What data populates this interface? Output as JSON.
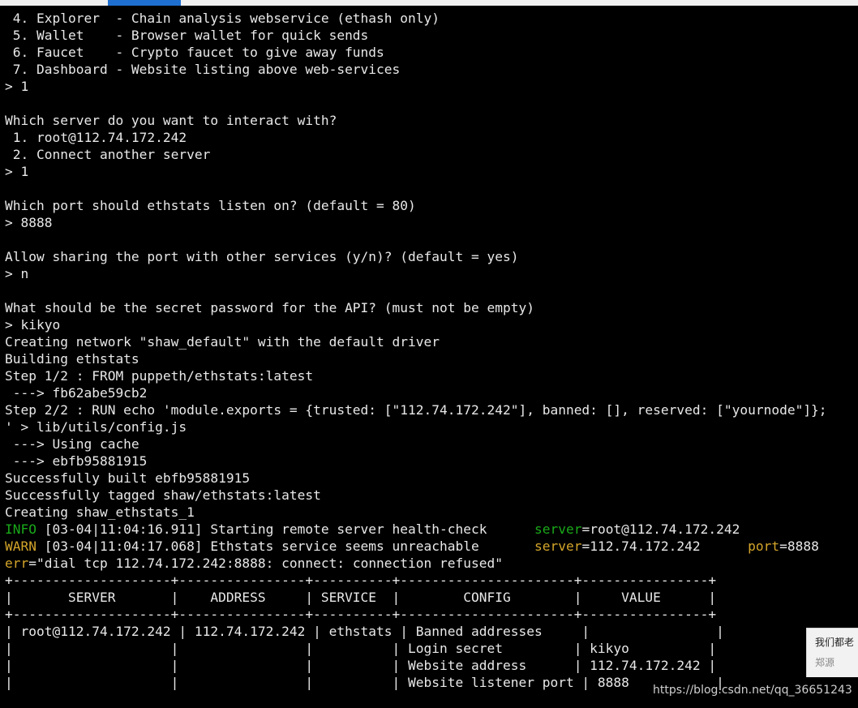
{
  "terminal": {
    "lines": [
      " 4. Explorer  - Chain analysis webservice (ethash only)",
      " 5. Wallet    - Browser wallet for quick sends",
      " 6. Faucet    - Crypto faucet to give away funds",
      " 7. Dashboard - Website listing above web-services",
      "> 1",
      "",
      "Which server do you want to interact with?",
      " 1. root@112.74.172.242",
      " 2. Connect another server",
      "> 1",
      "",
      "Which port should ethstats listen on? (default = 80)",
      "> 8888",
      "",
      "Allow sharing the port with other services (y/n)? (default = yes)",
      "> n",
      "",
      "What should be the secret password for the API? (must not be empty)",
      "> kikyo",
      "Creating network \"shaw_default\" with the default driver",
      "Building ethstats",
      "Step 1/2 : FROM puppeth/ethstats:latest",
      " ---> fb62abe59cb2",
      "Step 2/2 : RUN echo 'module.exports = {trusted: [\"112.74.172.242\"], banned: [], reserved: [\"yournode\"]};",
      "' > lib/utils/config.js",
      " ---> Using cache",
      " ---> ebfb95881915",
      "Successfully built ebfb95881915",
      "Successfully tagged shaw/ethstats:latest",
      "Creating shaw_ethstats_1"
    ],
    "log_info": {
      "level": "INFO",
      "message": " [03-04|11:04:16.911] Starting remote server health-check      ",
      "key": "server",
      "value": "=root@112.74.172.242"
    },
    "log_warn": {
      "level": "WARN",
      "message": " [03-04|11:04:17.068] Ethstats service seems unreachable       ",
      "key1": "server",
      "value1": "=112.74.172.242      ",
      "key2": "port",
      "value2": "=8888"
    },
    "log_err": {
      "key": "err",
      "value": "=\"dial tcp 112.74.172.242:8888: connect: connection refused\""
    },
    "table_lines": [
      "+--------------------+----------------+----------+----------------------+----------------+",
      "|       SERVER       |    ADDRESS     | SERVICE  |        CONFIG        |     VALUE      |",
      "+--------------------+----------------+----------+----------------------+----------------+",
      "| root@112.74.172.242 | 112.74.172.242 | ethstats | Banned addresses     |                |",
      "|                    |                |          | Login secret         | kikyo          |",
      "|                    |                |          | Website address      | 112.74.172.242 |",
      "|                    |                |          | Website listener port | 8888           |"
    ]
  },
  "popup": {
    "text": "我们都老",
    "subtext": "郑源"
  },
  "watermark": "https://blog.csdn.net/qq_36651243",
  "colors": {
    "background": "#000000",
    "text": "#e8e8e8",
    "info": "#1aa81a",
    "warn": "#d4a52a"
  }
}
